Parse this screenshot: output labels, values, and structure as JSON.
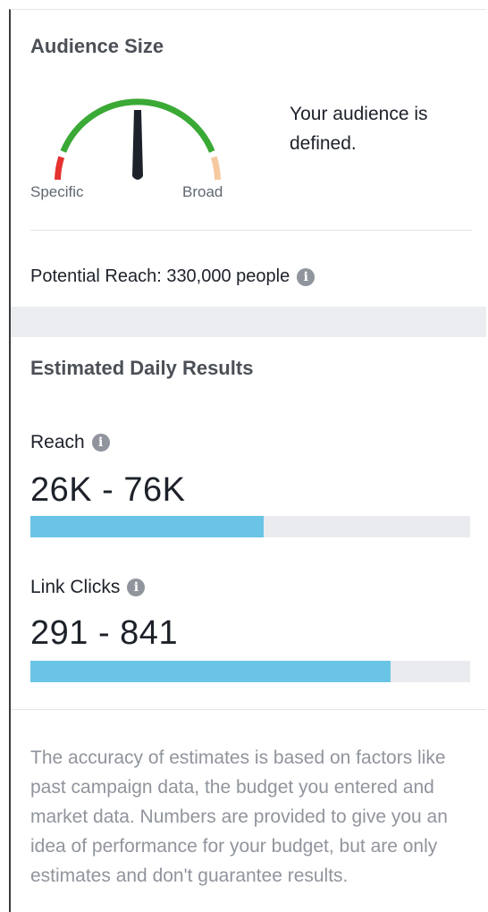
{
  "audience_size": {
    "title": "Audience Size",
    "gauge": {
      "left_label": "Specific",
      "right_label": "Broad",
      "level": 0.5,
      "colors": {
        "specific": "#e5312f",
        "good": "#3aa935",
        "broad": "#f6c9a1",
        "needle": "#1d2129"
      }
    },
    "status_text": "Your audience is defined.",
    "potential_reach": "Potential Reach: 330,000 people",
    "info_icon": "info-icon"
  },
  "estimated_daily_results": {
    "title": "Estimated Daily Results",
    "metrics": [
      {
        "label": "Reach",
        "value": "26K - 76K",
        "fill_fraction": 0.53,
        "info_icon": "info-icon"
      },
      {
        "label": "Link Clicks",
        "value": "291 - 841",
        "fill_fraction": 0.82,
        "info_icon": "info-icon"
      }
    ],
    "bar_color": "#6ac4e6"
  },
  "footnote": "The accuracy of estimates is based on factors like past campaign data, the budget you entered and market data. Numbers are provided to give you an idea of performance for your budget, but are only estimates and don't guarantee results."
}
